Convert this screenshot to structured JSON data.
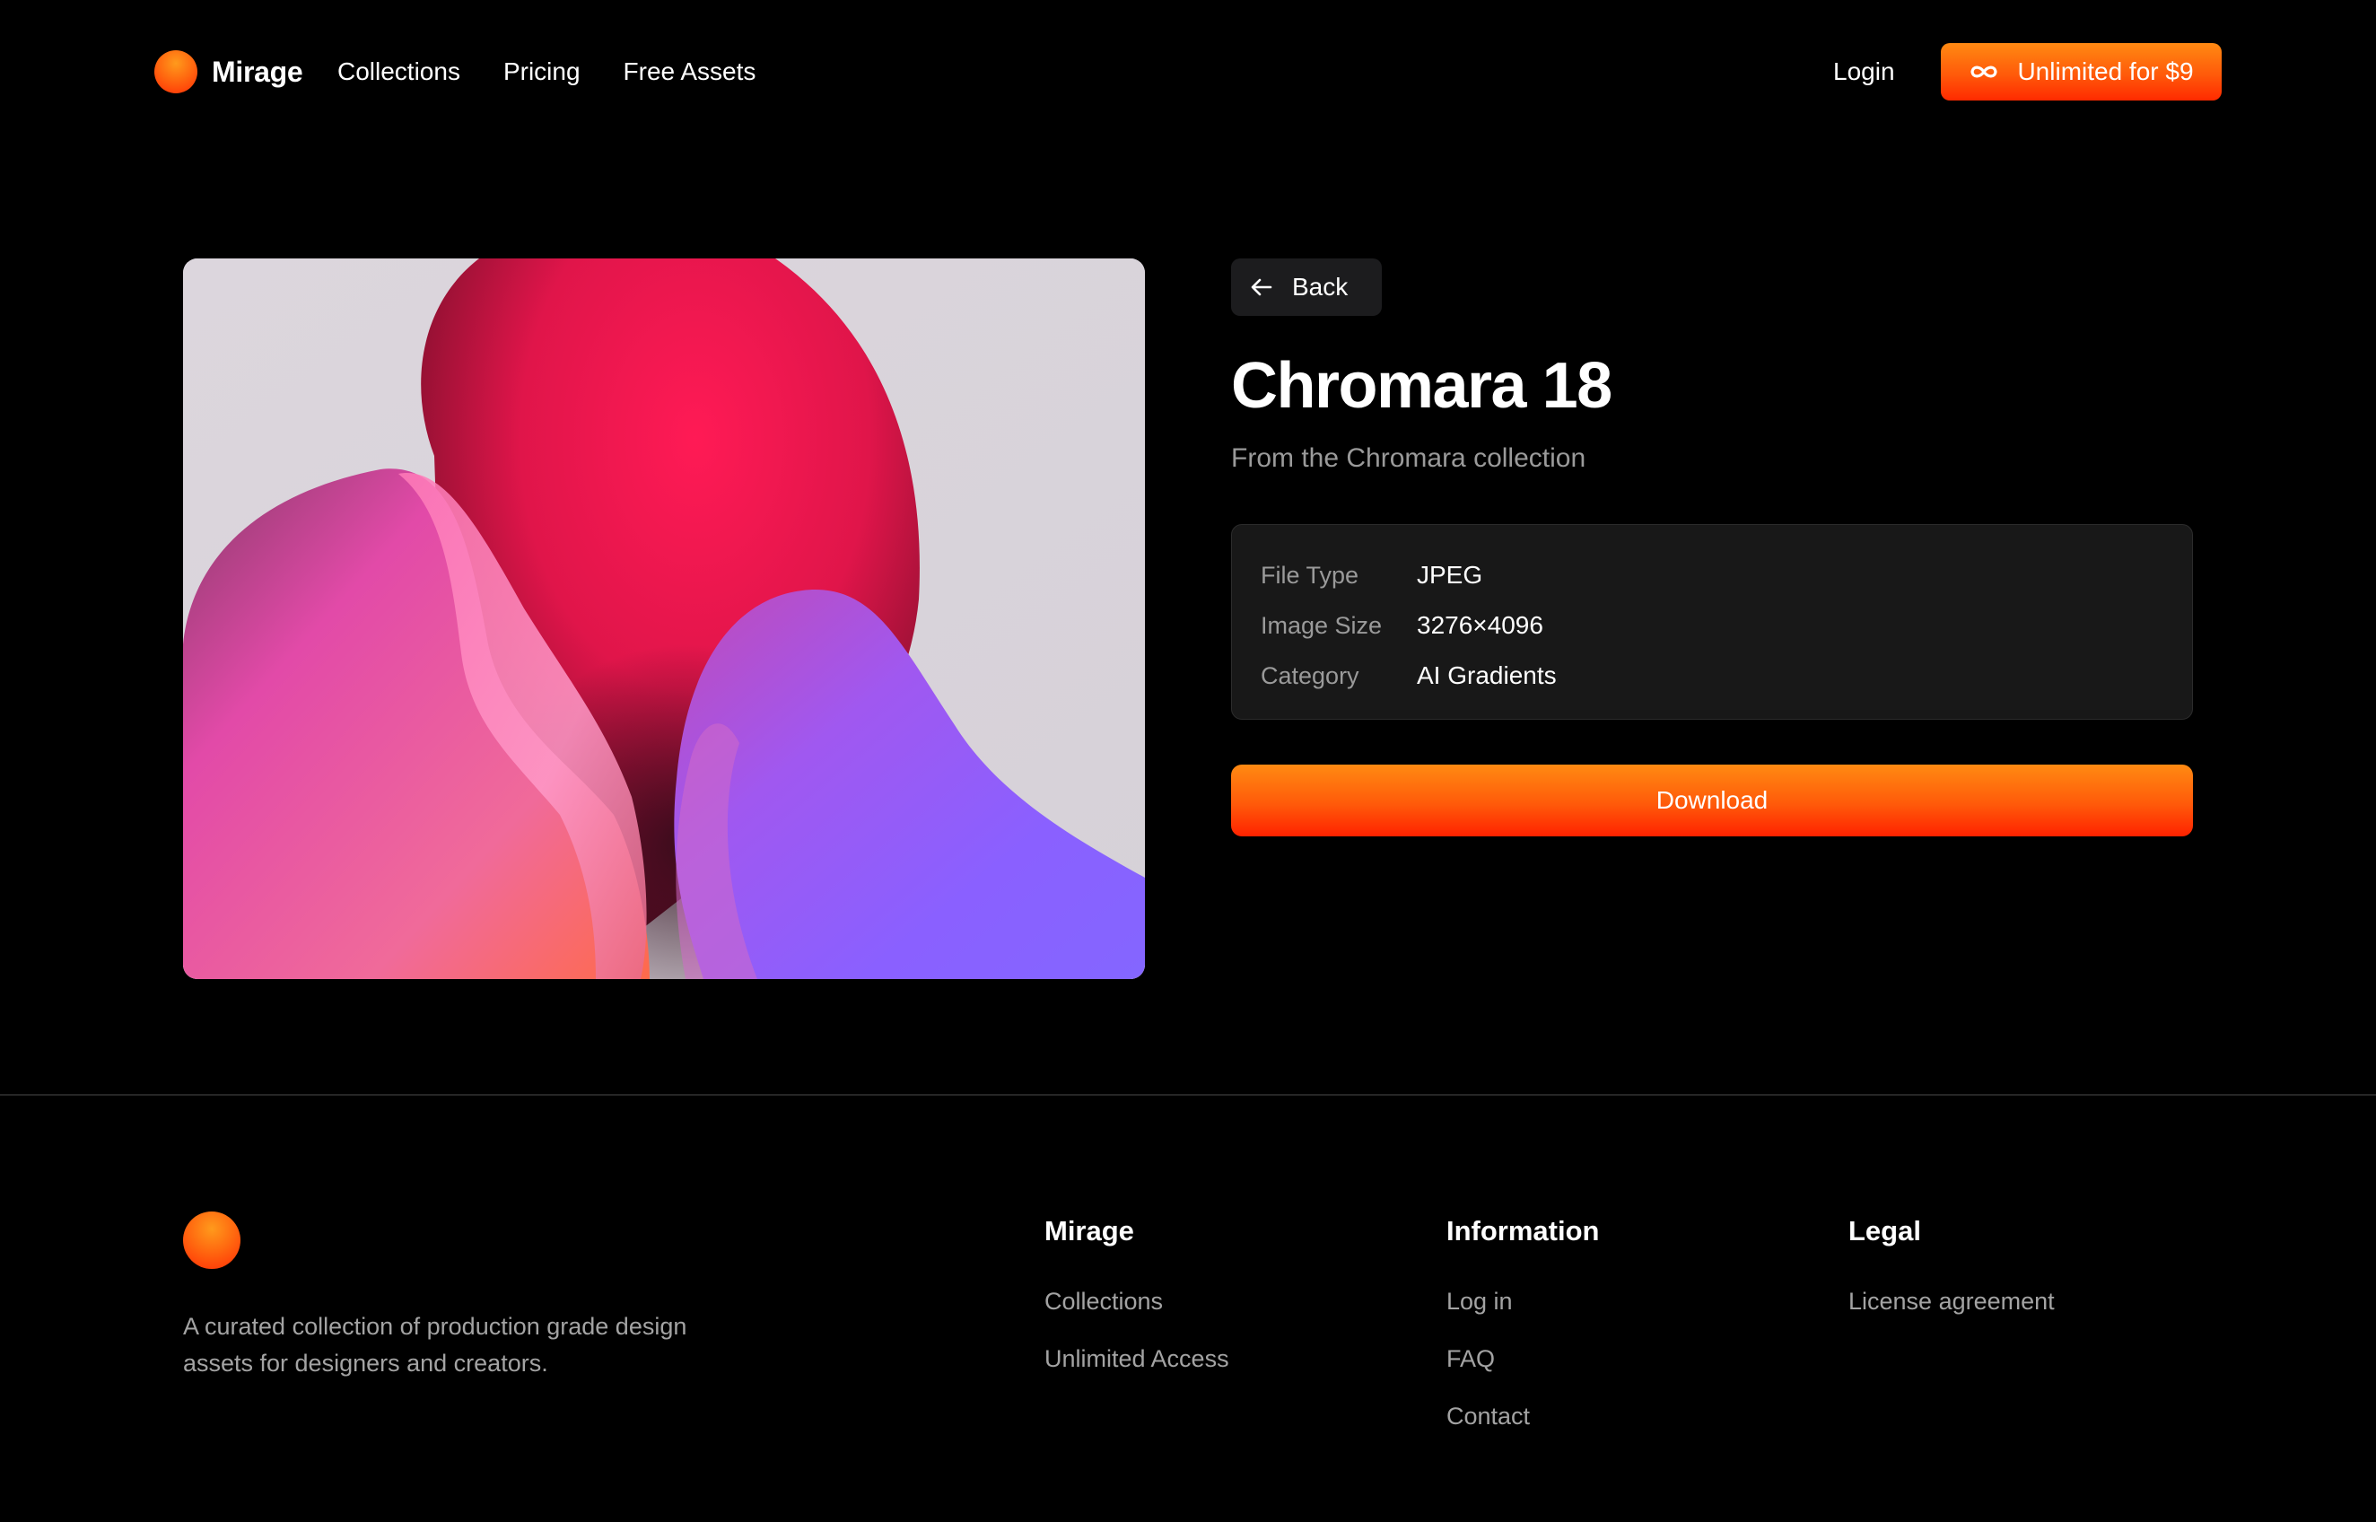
{
  "header": {
    "brand": "Mirage",
    "nav": [
      "Collections",
      "Pricing",
      "Free Assets"
    ],
    "login": "Login",
    "cta_label": "Unlimited for $9"
  },
  "asset": {
    "back_label": "Back",
    "title": "Chromara 18",
    "subtitle": "From the Chromara collection",
    "specs": [
      {
        "key": "File Type",
        "value": "JPEG"
      },
      {
        "key": "Image Size",
        "value": "3276×4096"
      },
      {
        "key": "Category",
        "value": "AI Gradients"
      }
    ],
    "download_label": "Download"
  },
  "footer": {
    "tagline": "A curated collection of production grade design assets for designers and creators.",
    "columns": [
      {
        "heading": "Mirage",
        "links": [
          "Collections",
          "Unlimited Access"
        ]
      },
      {
        "heading": "Information",
        "links": [
          "Log in",
          "FAQ",
          "Contact"
        ]
      },
      {
        "heading": "Legal",
        "links": [
          "License agreement"
        ]
      }
    ]
  },
  "colors": {
    "background": "#000000",
    "accent": "#ff5a0a",
    "card": "#181818",
    "muted_text": "#9a9a9a"
  },
  "icons": {
    "cta": "infinity-icon",
    "back": "arrow-left-icon",
    "logo": "orb-logo-icon"
  }
}
